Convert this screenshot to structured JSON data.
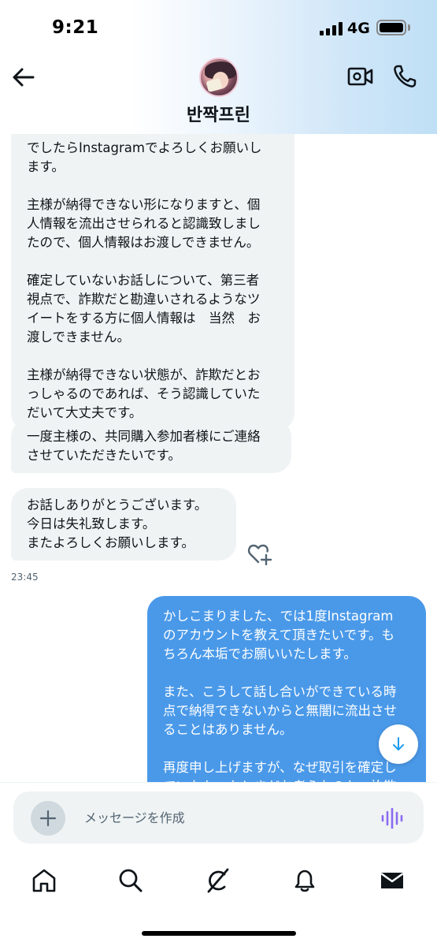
{
  "status_bar": {
    "time": "9:21",
    "network": "4G"
  },
  "header": {
    "chat_name": "반짝프린"
  },
  "messages": [
    {
      "direction": "in",
      "text": "でしたらInstagramでよろしくお願いし\nます。\n\n主様が納得できない形になりますと、個\n人情報を流出させられると認識致しまし\nたので、個人情報はお渡しできません。\n\n確定していないお話しについて、第三者\n視点で、詐欺だと勘違いされるようなツ\nイートをする方に個人情報は　当然　お\n渡しできません。\n\n主様が納得できない状態が、詐欺だとお\nっしゃるのであれば、そう認識していた\nだいて大丈夫です。"
    },
    {
      "direction": "in",
      "text": "一度主様の、共同購入参加者様にご連絡\nさせていただきたいです。"
    },
    {
      "direction": "in",
      "text": "お話しありがとうございます。\n今日は失礼致します。\nまたよろしくお願いします。",
      "time": "23:45"
    },
    {
      "direction": "out",
      "text": "かしこまりました、では1度Instagram\nのアカウントを教えて頂きたいです。も\nちろん本垢でお願いいたします。\n\nまた、こうして話し合いができている時\n点で納得できないからと無闇に流出させ\nることはありません。\n\n再度申し上げますが、なぜ取引を確定し\nていなかったとまだお考えなのか、詐欺"
    }
  ],
  "composer": {
    "placeholder": "メッセージを作成"
  },
  "colors": {
    "outgoing_bubble": "#4a99e9",
    "incoming_bubble": "#eff3f4",
    "voice_icon": "#8a6cf0"
  },
  "icons": {
    "header": [
      "back-arrow-icon",
      "video-call-icon",
      "phone-icon"
    ],
    "tabs": [
      "home-icon",
      "search-icon",
      "grok-icon",
      "notifications-icon",
      "messages-icon"
    ]
  }
}
